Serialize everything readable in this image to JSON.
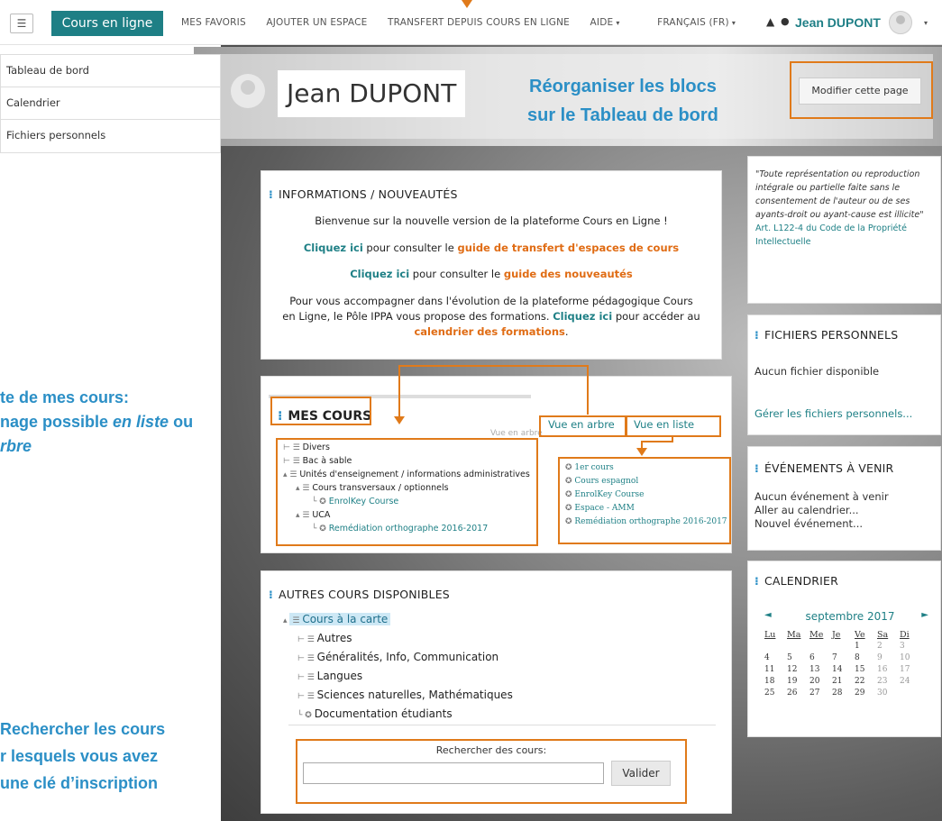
{
  "nav": {
    "menu_icon": "hamburger-icon",
    "brand": "Cours en ligne",
    "links": [
      "MES FAVORIS",
      "AJOUTER UN ESPACE",
      "TRANSFERT DEPUIS COURS EN LIGNE",
      "AIDE",
      "FRANÇAIS (FR)"
    ],
    "user": "Jean DUPONT",
    "accent_color": "#1e7f85"
  },
  "sidebar": {
    "items": [
      "Tableau de bord",
      "Calendrier",
      "Fichiers personnels"
    ]
  },
  "header": {
    "name": "Jean DUPONT",
    "edit_button": "Modifier cette page"
  },
  "annotations": {
    "reorg_line1": "Réorganiser les blocs",
    "reorg_line2": "sur le Tableau de bord",
    "courses_line1": "te de mes cours:",
    "courses_line2a": "nage possible ",
    "courses_line2b": "en liste",
    "courses_line2c": " ou",
    "courses_line3": "rbre",
    "search_line1": "Rechercher les cours",
    "search_line2": "r lesquels vous avez",
    "search_line3": "une clé d’inscription",
    "color": "#2b8fc6",
    "outline_color": "#e07a1a"
  },
  "info": {
    "title": "INFORMATIONS / NOUVEAUTÉS",
    "welcome": "Bienvenue sur la nouvelle version de la plateforme Cours en Ligne !",
    "l1_link": "Cliquez ici",
    "l1_mid": " pour consulter le ",
    "l1_orange": "guide de transfert d'espaces de cours",
    "l2_link": "Cliquez ici",
    "l2_mid": " pour consulter le ",
    "l2_orange": "guide des nouveautés",
    "p_line1": "Pour vous accompagner dans l'évolution de la plateforme pédagogique Cours",
    "p_line2a": "en Ligne, le Pôle IPPA vous propose des formations. ",
    "p_line2_link": "Cliquez ici",
    "p_line2b": " pour accéder au",
    "p_line3_orange": "calendrier des formations",
    "p_line3_end": "."
  },
  "courses": {
    "title": "MES COURS",
    "tab_tree": "Vue en arbre",
    "tab_list": "Vue en liste",
    "faint": "Vue en arbre",
    "tree": [
      "Divers",
      "Bac à sable",
      "Unités d'enseignement / informations administratives",
      "Cours transversaux / optionnels",
      "EnrolKey Course",
      "UCA",
      "Remédiation orthographe 2016-2017"
    ],
    "list": [
      "1er cours",
      "Cours espagnol",
      "EnrolKey Course",
      "Espace - AMM",
      "Remédiation orthographe 2016-2017"
    ]
  },
  "autres": {
    "title": "AUTRES COURS DISPONIBLES",
    "root": "Cours à la carte",
    "children": [
      "Autres",
      "Généralités, Info, Communication",
      "Langues",
      "Sciences naturelles, Mathématiques",
      "Documentation étudiants"
    ],
    "search_label": "Rechercher des cours:",
    "search_button": "Valider",
    "search_value": ""
  },
  "quote": {
    "text": "\"Toute représentation ou reproduction intégrale ou partielle faite sans le consentement de l'auteur ou de ses ayants-droit ou ayant-cause est illicite\"",
    "link": " Art. L122-4 du Code de la Propriété Intellectuelle"
  },
  "fichiers": {
    "title": "FICHIERS PERSONNELS",
    "empty": "Aucun fichier disponible",
    "manage": "Gérer les fichiers personnels..."
  },
  "events": {
    "title": "ÉVÉNEMENTS À VENIR",
    "empty": "Aucun événement à venir",
    "goto": "Aller au calendrier...",
    "new": "Nouvel événement..."
  },
  "calendar": {
    "title": "CALENDRIER",
    "month": "septembre 2017",
    "prev": "◄",
    "next": "►",
    "days": [
      "Lu",
      "Ma",
      "Me",
      "Je",
      "Ve",
      "Sa",
      "Di"
    ],
    "weeks": [
      [
        "",
        "",
        "",
        "",
        "1",
        "2",
        "3"
      ],
      [
        "4",
        "5",
        "6",
        "7",
        "8",
        "9",
        "10"
      ],
      [
        "11",
        "12",
        "13",
        "14",
        "15",
        "16",
        "17"
      ],
      [
        "18",
        "19",
        "20",
        "21",
        "22",
        "23",
        "24"
      ],
      [
        "25",
        "26",
        "27",
        "28",
        "29",
        "30",
        ""
      ]
    ]
  }
}
